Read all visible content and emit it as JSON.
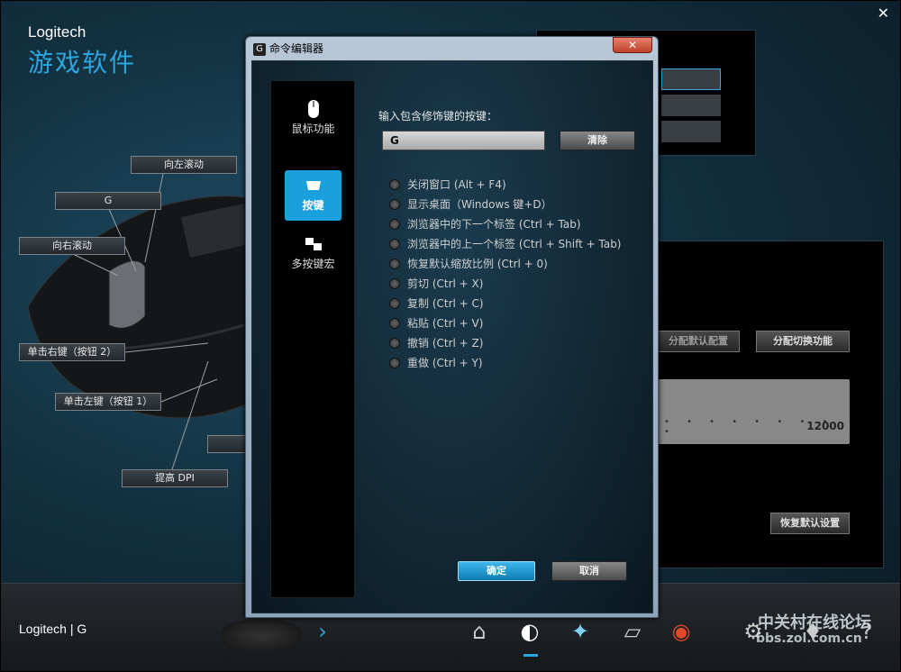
{
  "app": {
    "brand_line1": "Logitech",
    "brand_line2": "游戏软件",
    "close_glyph": "✕"
  },
  "callouts": [
    {
      "label": "向左滚动"
    },
    {
      "label": "G"
    },
    {
      "label": "向右滚动"
    },
    {
      "label": "单击右键（按钮 2）"
    },
    {
      "label": "单击左键（按钮 1）"
    },
    {
      "label": "提高 DPI"
    }
  ],
  "right": {
    "assign_default": "分配默认配置",
    "assign_switch": "分配切换功能",
    "dpi_max": "12000",
    "restore_default": "恢复默认设置"
  },
  "bottom": {
    "logo": "Logitech | G",
    "watermark": "中关村在线论坛",
    "watermark_url": "bbs.zol.com.cn"
  },
  "dialog": {
    "title": "命令编辑器",
    "close_glyph": "✕",
    "sidebar": [
      {
        "label": "鼠标功能",
        "icon": "mouse-icon"
      },
      {
        "label": "按键",
        "icon": "key-icon",
        "active": true
      },
      {
        "label": "多按键宏",
        "icon": "multikey-icon"
      }
    ],
    "prompt": "输入包含修饰键的按键：",
    "key_value": "G",
    "clear_label": "清除",
    "options": [
      "关闭窗口 (Alt + F4)",
      "显示桌面（Windows 键+D）",
      "浏览器中的下一个标签 (Ctrl + Tab)",
      "浏览器中的上一个标签 (Ctrl + Shift + Tab)",
      "恢复默认缩放比例 (Ctrl + 0)",
      "剪切 (Ctrl + X)",
      "复制 (Ctrl + C)",
      "粘贴 (Ctrl + V)",
      "撤销 (Ctrl + Z)",
      "重做 (Ctrl + Y)"
    ],
    "ok_label": "确定",
    "cancel_label": "取消"
  }
}
